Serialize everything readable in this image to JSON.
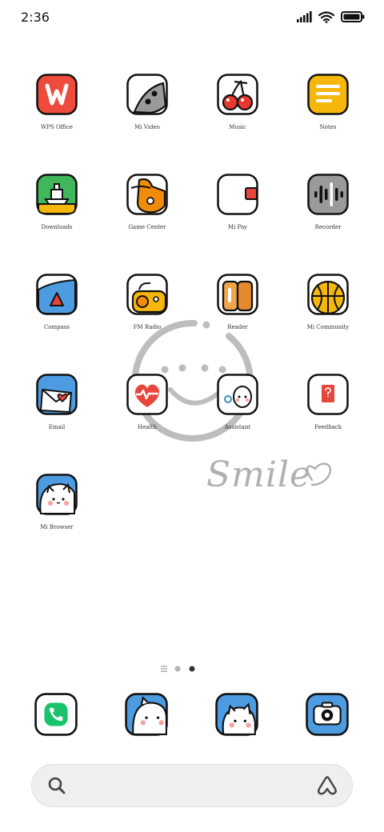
{
  "status": {
    "time": "2:36"
  },
  "wallpaper": {
    "handwriting": "Smile"
  },
  "apps": [
    {
      "label": "WPS Office",
      "icon": "wps-office-icon"
    },
    {
      "label": "Mi Video",
      "icon": "mi-video-icon"
    },
    {
      "label": "Music",
      "icon": "cherry-icon"
    },
    {
      "label": "Notes",
      "icon": "notes-icon"
    },
    {
      "label": "Downloads",
      "icon": "boat-icon"
    },
    {
      "label": "Game Center",
      "icon": "game-center-icon"
    },
    {
      "label": "Mi Pay",
      "icon": "wallet-icon"
    },
    {
      "label": "Recorder",
      "icon": "waveform-icon"
    },
    {
      "label": "Compass",
      "icon": "compass-icon"
    },
    {
      "label": "FM Radio",
      "icon": "radio-icon"
    },
    {
      "label": "Reader",
      "icon": "books-icon"
    },
    {
      "label": "Mi Community",
      "icon": "basketball-icon"
    },
    {
      "label": "Email",
      "icon": "envelope-icon"
    },
    {
      "label": "Health",
      "icon": "heart-pulse-icon"
    },
    {
      "label": "Assistant",
      "icon": "assistant-icon"
    },
    {
      "label": "Feedback",
      "icon": "feedback-icon"
    },
    {
      "label": "Mi Browser",
      "icon": "cat-browser-icon"
    }
  ],
  "dock": [
    {
      "icon": "phone-icon"
    },
    {
      "icon": "cat-messages-icon"
    },
    {
      "icon": "cat-contacts-icon"
    },
    {
      "icon": "camera-icon"
    }
  ],
  "page_indicator": {
    "pages": 3,
    "current": 2
  },
  "colors": {
    "accent_phone": "#19c36a",
    "brand_wps": "#ef4b3c",
    "notes_yellow": "#f6b70c",
    "blue": "#4d9be0"
  }
}
